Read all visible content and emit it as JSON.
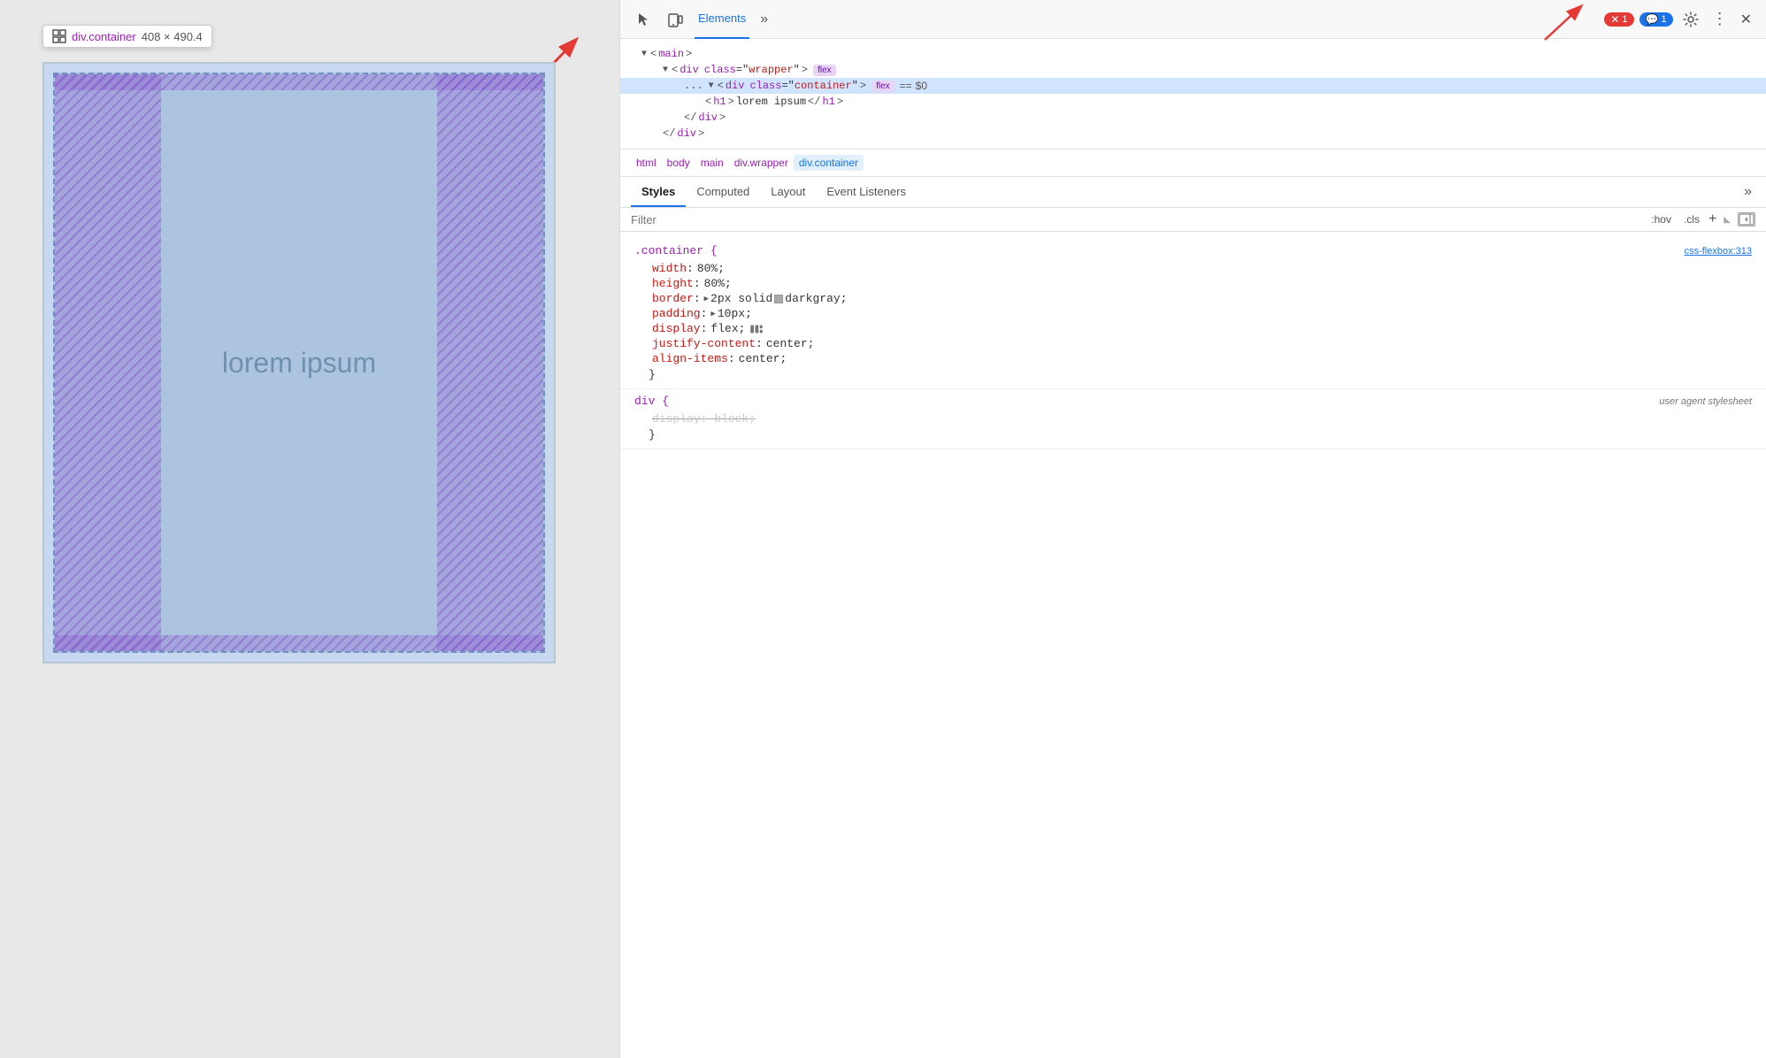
{
  "viewport": {
    "tooltip": {
      "class": "div.container",
      "size": "408 × 490.4"
    },
    "lorem_text": "lorem ipsum"
  },
  "devtools": {
    "header": {
      "cursor_icon": "cursor-icon",
      "device_icon": "device-icon",
      "tabs": [
        {
          "label": "Elements",
          "active": true
        },
        {
          "label": "»"
        }
      ],
      "error_count": "1",
      "info_count": "1"
    },
    "dom_tree": {
      "lines": [
        {
          "indent": 1,
          "content": "▼ <main>"
        },
        {
          "indent": 2,
          "content": "▼ <div class=\"wrapper\">",
          "badge": "flex"
        },
        {
          "indent": 3,
          "content": "▼ <div class=\"container\">",
          "badge": "flex",
          "selected": true,
          "equals": "==",
          "dollar": "$0"
        },
        {
          "indent": 4,
          "content": "<h1>lorem ipsum</h1>"
        },
        {
          "indent": 3,
          "content": "</div>"
        },
        {
          "indent": 2,
          "content": "</div>"
        }
      ],
      "dots_label": "..."
    },
    "breadcrumb": {
      "items": [
        "html",
        "body",
        "main",
        "div.wrapper",
        "div.container"
      ],
      "active_index": 4
    },
    "subtabs": [
      "Styles",
      "Computed",
      "Layout",
      "Event Listeners",
      "»"
    ],
    "active_subtab": "Styles",
    "filter": {
      "placeholder": "Filter",
      "hov_btn": ":hov",
      "cls_btn": ".cls",
      "add_btn": "+",
      "toggle_sidebar": "◀"
    },
    "css_rules": [
      {
        "id": "container-rule",
        "selector": ".container {",
        "source": "css-flexbox:313",
        "closing": "}",
        "properties": [
          {
            "name": "width",
            "value": "80%"
          },
          {
            "name": "height",
            "value": "80%"
          },
          {
            "name": "border",
            "value": "2px solid",
            "has_swatch": true,
            "swatch_color": "darkgray",
            "value_after": "darkgray;"
          },
          {
            "name": "padding",
            "value": "10px",
            "has_expand": true
          },
          {
            "name": "display",
            "value": "flex",
            "has_flex_icon": true
          },
          {
            "name": "justify-content",
            "value": "center"
          },
          {
            "name": "align-items",
            "value": "center"
          }
        ]
      },
      {
        "id": "div-rule",
        "selector": "div {",
        "source_italic": "user agent stylesheet",
        "closing": "}",
        "properties": [
          {
            "name": "display: block;",
            "strikethrough": true
          }
        ]
      }
    ]
  }
}
